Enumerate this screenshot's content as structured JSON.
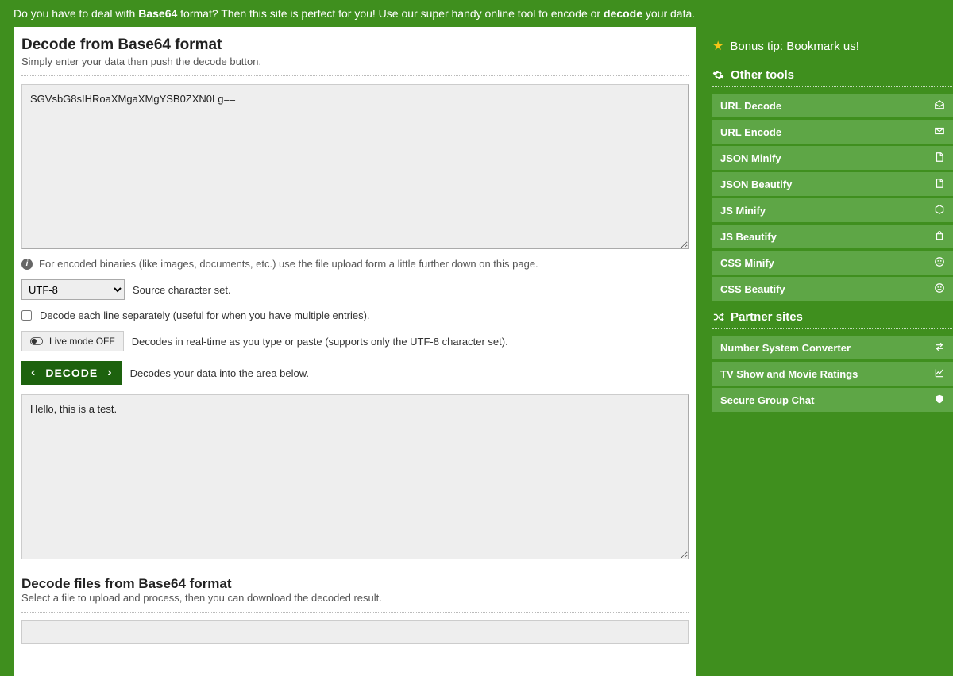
{
  "tagline": {
    "part1": "Do you have to deal with ",
    "bold1": "Base64",
    "part2": " format? Then this site is perfect for you! Use our super handy online tool to encode or ",
    "bold2": "decode",
    "part3": " your data."
  },
  "decode_section": {
    "title": "Decode from Base64 format",
    "subtitle": "Simply enter your data then push the decode button.",
    "input_value": "SGVsbG8sIHRoaXMgaXMgYSB0ZXN0Lg==",
    "binary_hint": "For encoded binaries (like images, documents, etc.) use the file upload form a little further down on this page.",
    "charset_value": "UTF-8",
    "charset_label": "Source character set.",
    "line_checkbox_label": "Decode each line separately (useful for when you have multiple entries).",
    "live_button": "Live mode OFF",
    "live_label": "Decodes in real-time as you type or paste (supports only the UTF-8 character set).",
    "decode_button": "DECODE",
    "decode_label": "Decodes your data into the area below.",
    "output_value": "Hello, this is a test."
  },
  "file_section": {
    "title": "Decode files from Base64 format",
    "subtitle": "Select a file to upload and process, then you can download the decoded result."
  },
  "sidebar": {
    "bonus": "Bonus tip: Bookmark us!",
    "other_tools_header": "Other tools",
    "tools": [
      {
        "label": "URL Decode",
        "icon": "mail-open-icon"
      },
      {
        "label": "URL Encode",
        "icon": "mail-icon"
      },
      {
        "label": "JSON Minify",
        "icon": "file-icon"
      },
      {
        "label": "JSON Beautify",
        "icon": "file-icon"
      },
      {
        "label": "JS Minify",
        "icon": "hex-icon"
      },
      {
        "label": "JS Beautify",
        "icon": "bag-icon"
      },
      {
        "label": "CSS Minify",
        "icon": "face-icon"
      },
      {
        "label": "CSS Beautify",
        "icon": "face-icon"
      }
    ],
    "partner_header": "Partner sites",
    "partners": [
      {
        "label": "Number System Converter",
        "icon": "swap-icon"
      },
      {
        "label": "TV Show and Movie Ratings",
        "icon": "chart-icon"
      },
      {
        "label": "Secure Group Chat",
        "icon": "shield-icon"
      }
    ]
  }
}
